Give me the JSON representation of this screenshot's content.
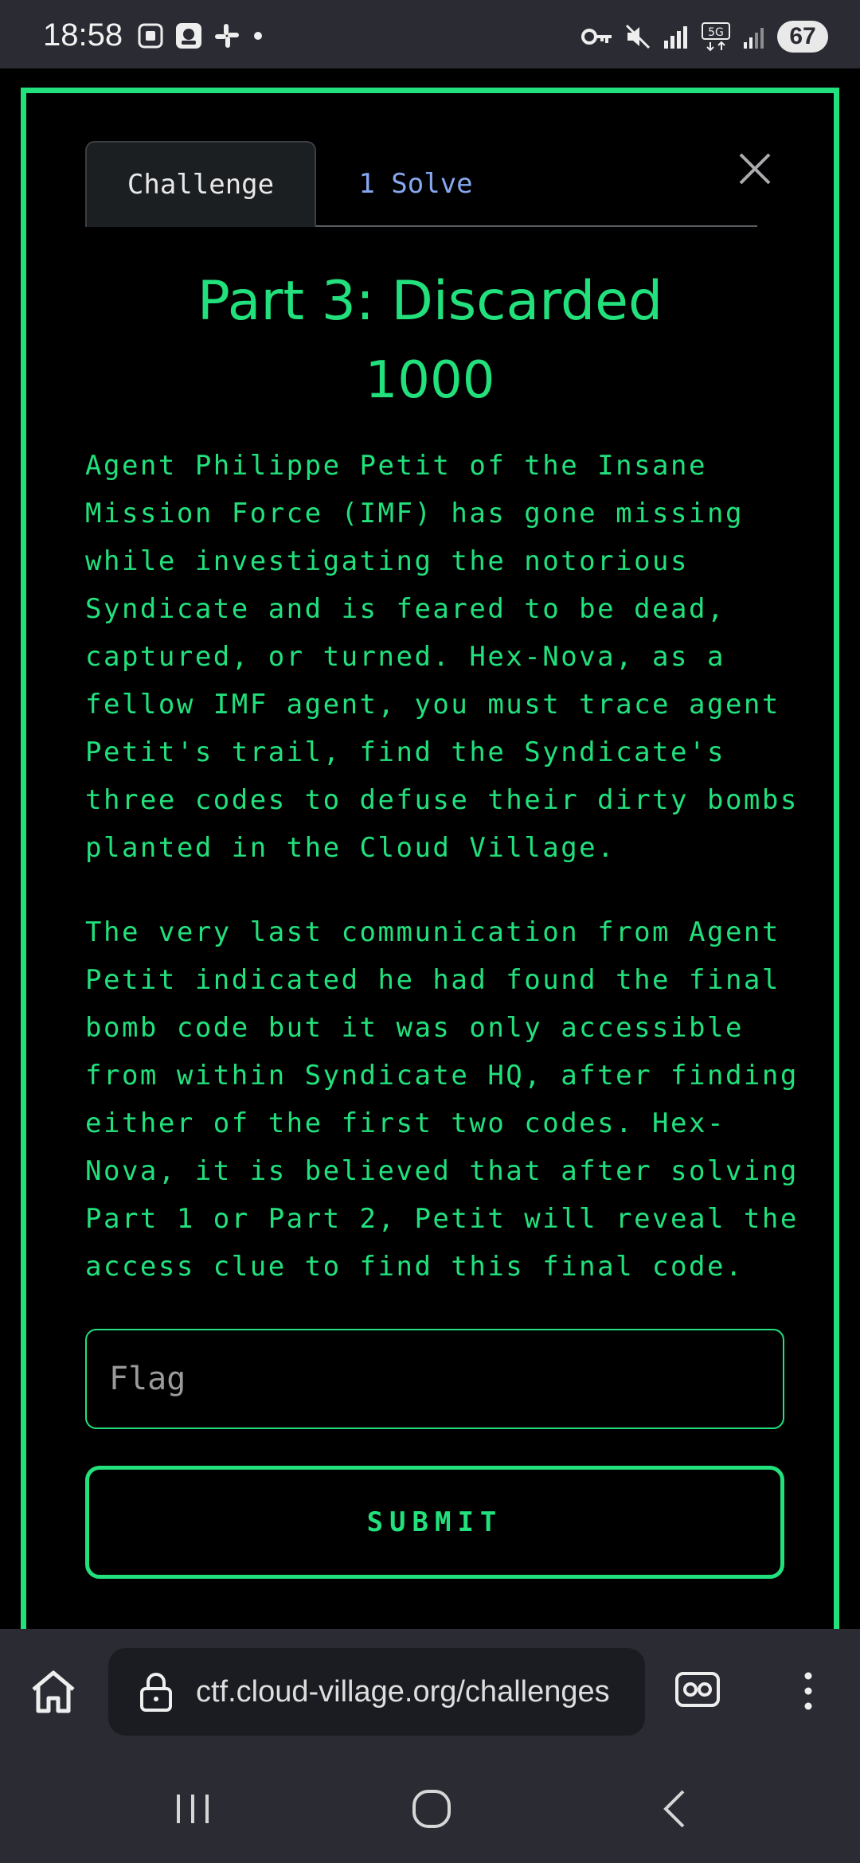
{
  "status_bar": {
    "time": "18:58",
    "left_icons": [
      "screenshot-icon",
      "app-icon",
      "slack-icon",
      "dot-icon"
    ],
    "right_icons": [
      "vpn-key-icon",
      "mute-icon",
      "signal-icon",
      "5g-icon",
      "signal-bars-icon"
    ],
    "battery": "67"
  },
  "challenge": {
    "tabs": [
      {
        "label": "Challenge",
        "active": true
      },
      {
        "label": "1 Solve",
        "active": false
      }
    ],
    "name": "Part 3: Discarded",
    "value": "1000",
    "description": [
      "Agent Philippe Petit of the Insane Mission Force (IMF) has gone missing while investigating the notorious Syndicate and is feared to be dead, captured, or turned. Hex-Nova, as a fellow IMF agent, you must trace agent Petit's trail, find the Syndicate's three codes to defuse their dirty bombs planted in the Cloud Village.",
      "The very last communication from Agent Petit indicated he had found the final bomb code but it was only accessible from within Syndicate HQ, after finding either of the first two codes. Hex-Nova, it is believed that after solving Part 1 or Part 2, Petit will reveal the access clue to find this final code."
    ],
    "flag_placeholder": "Flag",
    "submit_label": "SUBMIT"
  },
  "browser": {
    "url": "ctf.cloud-village.org/challenges"
  },
  "colors": {
    "accent": "#22e07c",
    "background": "#000000",
    "chrome": "#2b2c33",
    "tab_link": "#86a8f0"
  }
}
